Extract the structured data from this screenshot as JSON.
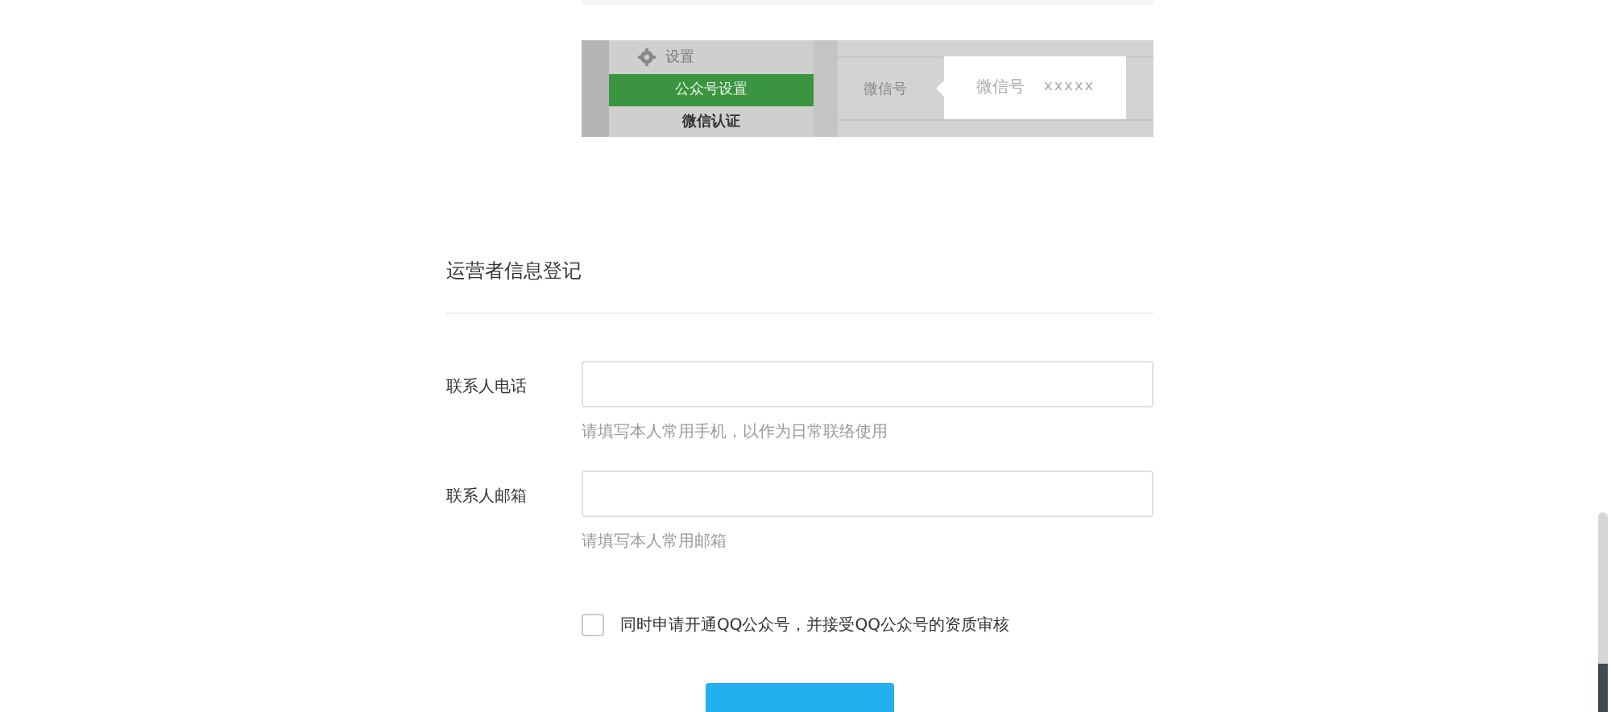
{
  "illustration": {
    "sidebar_header": "设置",
    "sidebar_items": [
      {
        "label": "公众号设置",
        "kind": "item",
        "selected": true
      },
      {
        "label": "微信认证",
        "kind": "item",
        "selected": false
      }
    ],
    "field_label": "微信号",
    "tooltip": {
      "label": "微信号",
      "value": "xxxxx"
    }
  },
  "section_title": "运营者信息登记",
  "fields": [
    {
      "label": "联系人电话",
      "hint": "请填写本人常用手机，以作为日常联络使用"
    },
    {
      "label": "联系人邮箱",
      "hint": "请填写本人常用邮箱"
    }
  ],
  "agreement": {
    "label": "同时申请开通QQ公众号，并接受QQ公众号的资质审核",
    "checked": false
  }
}
